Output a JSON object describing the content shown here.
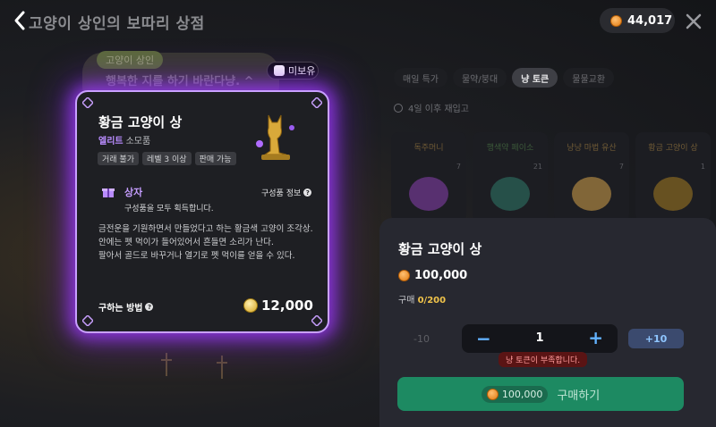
{
  "header": {
    "title": "고양이 상인의 보따리 상점",
    "currency_value": "44,017"
  },
  "background": {
    "merchant_tag": "고양이 상인",
    "merchant_message": "행복한 지를 하기 바란다냥. ^",
    "unowned_label": "미보유"
  },
  "tabs": [
    {
      "label": "매일 특가",
      "active": false
    },
    {
      "label": "물약/붕대",
      "active": false
    },
    {
      "label": "냥 토큰",
      "active": true
    },
    {
      "label": "물물교환",
      "active": false
    }
  ],
  "restock_text": "4일 이후 재입고",
  "grid_items": [
    {
      "name": "독주머니",
      "count": "7",
      "color": "#8a3fb0"
    },
    {
      "name": "행색약 페이소",
      "count": "21",
      "color": "#2f7a6a"
    },
    {
      "name": "냥냥 마법 유산",
      "count": "7",
      "color": "#d6a24a"
    },
    {
      "name": "황금 고양이 상",
      "count": "1",
      "color": "#a67c20"
    }
  ],
  "card": {
    "name": "황금 고양이 상",
    "grade": "엘리트",
    "grade_sub": "소모품",
    "chips": [
      "거래 불가",
      "레벨 3 이상",
      "판매 가능"
    ],
    "box_label": "상자",
    "box_info": "구성품 정보",
    "box_desc": "구성품을 모두 획득합니다.",
    "description": "금전운을 기원하면서 만들었다고 하는 황금색 고양이 조각상.\n안에는 펫 먹이가 들어있어서 흔들면 소리가 난다.\n팔아서 골드로 바꾸거나 열기로 펫 먹이를 얻을 수 있다.",
    "howto": "구하는 방법",
    "price": "12,000"
  },
  "panel": {
    "title": "황금 고양이 상",
    "price": "100,000",
    "limit_label": "구매",
    "limit_value": "0/200",
    "minus10": "-10",
    "minus": "−",
    "quantity": "1",
    "plus": "+",
    "plus10": "+10",
    "warning": "냥 토큰이 부족합니다.",
    "buy_cost": "100,000",
    "buy_label": "구매하기"
  },
  "colors": {
    "accent_purple": "#b98cff",
    "glow": "#a03cff",
    "buy_green": "#1d8a62",
    "token_orange": "#e07a10"
  }
}
